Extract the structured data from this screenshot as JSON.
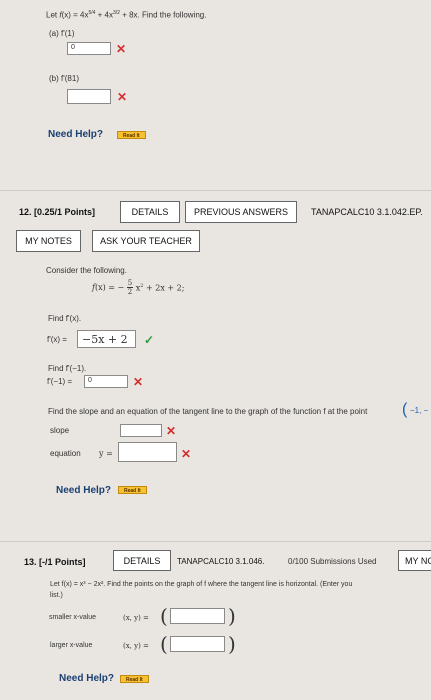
{
  "q11": {
    "prompt": "Let f(x) = 4x^5/4 + 4x^3/2 + 8x. Find the following.",
    "part_a": {
      "label": "(a) f'(1)",
      "value": "0"
    },
    "part_b": {
      "label": "(b) f'(81)",
      "value": ""
    },
    "need_help": "Need Help?",
    "read_it": "Read It"
  },
  "q12": {
    "number": "12. [0.25/1 Points]",
    "tabs": [
      "DETAILS",
      "PREVIOUS ANSWERS",
      "TANAPCALC10 3.1.042.EP."
    ],
    "actions": [
      "MY NOTES",
      "ASK YOUR TEACHER"
    ],
    "consider": "Consider the following.",
    "function": "f(x) = -(5/2)x² + 2x + 2;",
    "find1": "Find f'(x).",
    "fprime_label": "f'(x) =",
    "fprime_value": "−5x + 2",
    "find2": "Find f'(−1).",
    "fprime_neg1_label": "f'(−1) =",
    "fprime_neg1_value": "0",
    "slope_prompt": "Find the slope and an equation of the tangent line to the graph of the function f at the point",
    "point_text": "−1, −",
    "slope_label": "slope",
    "equation_label": "equation",
    "y_eq": "y =",
    "need_help": "Need Help?",
    "read_it": "Read It"
  },
  "q13": {
    "number": "13. [-/1 Points]",
    "details": "DETAILS",
    "code": "TANAPCALC10 3.1.046.",
    "submissions": "0/100 Submissions Used",
    "my_notes_partial": "MY NC",
    "prompt_line1": "Let f(x) = x³ − 2x². Find the points on the graph of f where the tangent line is horizontal. (Enter you",
    "prompt_line2": "list.)",
    "smaller_label": "smaller x-value",
    "larger_label": "larger x-value",
    "xy_label": "(x, y) =",
    "need_help": "Need Help?",
    "read_it": "Read It"
  }
}
